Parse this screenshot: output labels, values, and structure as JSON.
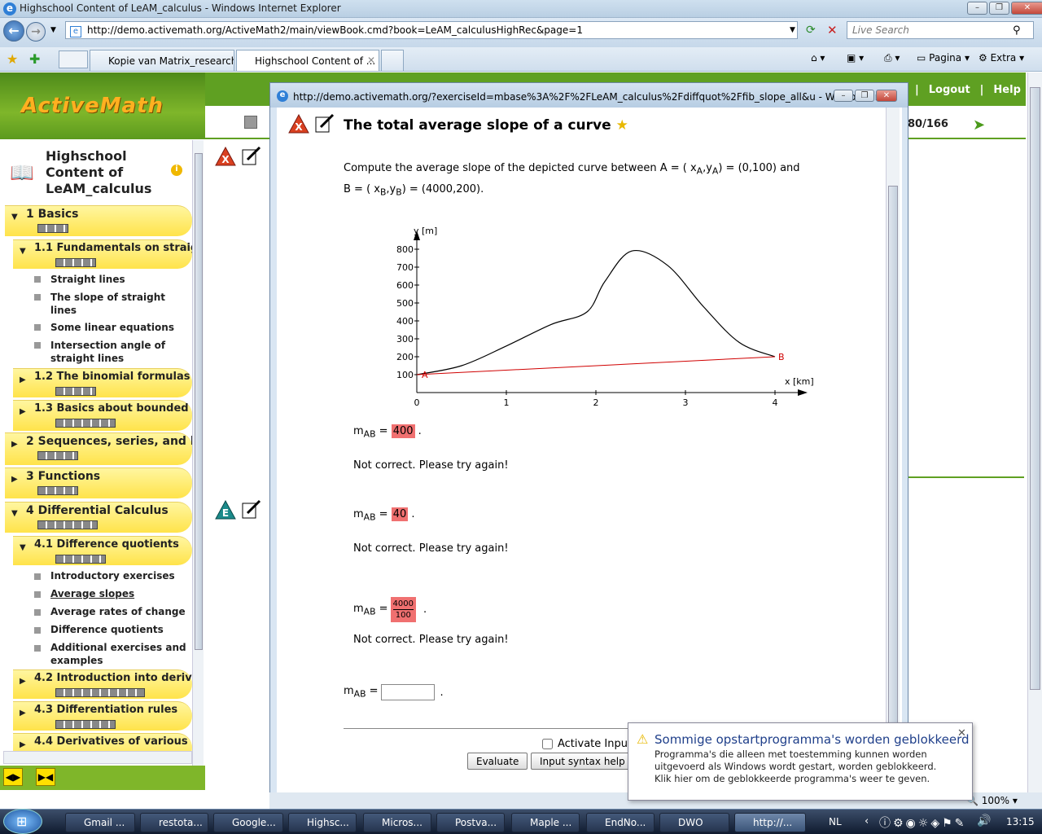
{
  "window": {
    "title": "Highschool Content of LeAM_calculus - Windows Internet Explorer"
  },
  "browser": {
    "url": "http://demo.activemath.org/ActiveMath2/main/viewBook.cmd?book=LeAM_calculusHighRec&page=1",
    "search_placeholder": "Live Search",
    "tabs": [
      "Kopie van Matrix_research ...",
      "Highschool Content of ..."
    ],
    "toolbar": {
      "page_label": "Pagina",
      "extra_label": "Extra"
    },
    "zoom": "100%"
  },
  "app": {
    "logo": "ActiveMath",
    "nav": {
      "logout": "Logout",
      "help": "Help"
    },
    "page_counter": "80/166"
  },
  "sidebar": {
    "book_title_lines": [
      "Highschool",
      "Content of",
      "LeAM_calculus"
    ],
    "sections": [
      {
        "label": "1 Basics",
        "progress": 0.0
      },
      {
        "label": "1.1 Fundamentals on straig",
        "progress": 0.0
      },
      {
        "label": "1.2 The binomial formulas",
        "progress": 0.0
      },
      {
        "label": "1.3 Basics about bounded",
        "progress": 0.0
      },
      {
        "label": "2 Sequences, series, and l",
        "progress": 0.0
      },
      {
        "label": "3 Functions",
        "progress": 0.0
      },
      {
        "label": "4 Differential Calculus",
        "progress": 0.0
      },
      {
        "label": "4.1 Difference quotients",
        "progress": 0.0
      },
      {
        "label": "4.2 Introduction into deriv",
        "progress": 0.0
      },
      {
        "label": "4.3 Differentiation rules",
        "progress": 0.0
      },
      {
        "label": "4.4 Derivatives of various",
        "progress": 0.0
      }
    ],
    "items_11": [
      {
        "lines": [
          "Straight lines"
        ]
      },
      {
        "lines": [
          "The slope of straight",
          "lines"
        ]
      },
      {
        "lines": [
          "Some linear equations"
        ]
      },
      {
        "lines": [
          "Intersection angle of",
          "straight lines"
        ]
      }
    ],
    "items_41": [
      {
        "lines": [
          "Introductory exercises"
        ]
      },
      {
        "lines": [
          "Average slopes"
        ]
      },
      {
        "lines": [
          "Average rates of change"
        ]
      },
      {
        "lines": [
          "Difference quotients"
        ]
      },
      {
        "lines": [
          "Additional exercises and",
          "examples"
        ]
      }
    ]
  },
  "popup": {
    "title": "http://demo.activemath.org/?exerciseId=mbase%3A%2F%2FLeAM_calculus%2Fdiffquot%2Ffib_slope_all&u - Windows Int...",
    "exercise_title": "The total average slope of a curve",
    "question_line1_prefix": "Compute the average slope of the depicted curve between A = ( x",
    "question_line1_sub1": "A",
    "question_line1_mid": ",y",
    "question_line1_sub2": "A",
    "question_line1_suffix": ") = (0,100) and",
    "question_line2_prefix": "B = ( x",
    "question_line2_sub1": "B",
    "question_line2_mid": ",y",
    "question_line2_sub2": "B",
    "question_line2_suffix": ") = (4000,200).",
    "answer_var": "m",
    "answer_sub": "AB",
    "attempts": [
      {
        "value": "400",
        "feedback": "Not correct. Please try again!"
      },
      {
        "value": "40",
        "feedback": "Not correct. Please try again!"
      },
      {
        "numerator": "4000",
        "denominator": "100",
        "feedback": "Not correct. Please try again!"
      }
    ],
    "input_value": "",
    "activate_input_label": "Activate Input",
    "evaluate_label": "Evaluate",
    "syntax_help_label": "Input syntax help"
  },
  "chart_data": {
    "type": "line",
    "xlabel": "x [km]",
    "ylabel": "y [m]",
    "x_ticks": [
      "0",
      "1",
      "2",
      "3",
      "4"
    ],
    "y_ticks": [
      "100",
      "200",
      "300",
      "400",
      "500",
      "600",
      "700",
      "800"
    ],
    "xlim": [
      0,
      4.2
    ],
    "ylim": [
      0,
      850
    ],
    "series": [
      {
        "x": [
          0,
          0.5,
          1.0,
          1.5,
          1.9,
          2.1,
          2.4,
          2.8,
          3.2,
          3.6,
          4.0
        ],
        "y": [
          100,
          150,
          260,
          380,
          450,
          620,
          790,
          710,
          480,
          280,
          200
        ],
        "color": "#000000"
      },
      {
        "x": [
          0,
          4.0
        ],
        "y": [
          100,
          200
        ],
        "color": "#d00000"
      }
    ],
    "points": [
      {
        "label": "A",
        "x": 0,
        "y": 100
      },
      {
        "label": "B",
        "x": 4,
        "y": 200
      }
    ]
  },
  "notification": {
    "title": "Sommige opstartprogramma's worden geblokkeerd",
    "message": "Programma's die alleen met toestemming kunnen worden uitgevoerd als Windows wordt gestart, worden geblokkeerd. Klik hier om de geblokkeerde programma's weer te geven."
  },
  "taskbar": {
    "buttons": [
      "Gmail ...",
      "restota...",
      "Google...",
      "Highsc...",
      "Micros...",
      "Postva...",
      "Maple ...",
      "EndNo...",
      "DWO",
      "http://..."
    ],
    "language": "NL",
    "clock": "13:15"
  }
}
